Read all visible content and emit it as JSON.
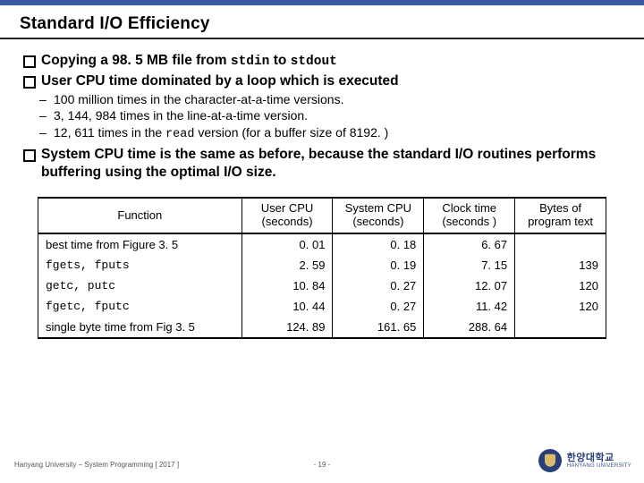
{
  "title": "Standard I/O Efficiency",
  "bullets": {
    "copying": {
      "a": "Copying a 98. 5 MB file from ",
      "stdin": "stdin",
      "b": " to ",
      "stdout": "stdout"
    },
    "user_cpu_head": "User CPU time dominated by a loop which is executed",
    "sub1": "100 million times in the character-at-a-time versions.",
    "sub2": "3, 144, 984 times in the line-at-a-time version.",
    "sub3": {
      "a": "12, 611 times in the ",
      "code": "read",
      "b": " version (for a buffer size of 8192. )"
    },
    "syscpu": "System CPU time is the same as before, because the standard I/O routines performs buffering using the optimal I/O size."
  },
  "table": {
    "headers": {
      "fn": "Function",
      "ucpu": "User CPU (seconds)",
      "scpu": "System CPU (seconds)",
      "clock": "Clock time (seconds )",
      "bytes": "Bytes of program text"
    },
    "rows": [
      {
        "fn_text": "best time from Figure 3. 5",
        "fn_mono": "",
        "ucpu": "0. 01",
        "scpu": "0. 18",
        "clock": "6. 67",
        "bytes": ""
      },
      {
        "fn_text": "",
        "fn_mono": "fgets, fputs",
        "ucpu": "2. 59",
        "scpu": "0. 19",
        "clock": "7. 15",
        "bytes": "139"
      },
      {
        "fn_text": "",
        "fn_mono": "getc, putc",
        "ucpu": "10. 84",
        "scpu": "0. 27",
        "clock": "12. 07",
        "bytes": "120"
      },
      {
        "fn_text": "",
        "fn_mono": "fgetc, fputc",
        "ucpu": "10. 44",
        "scpu": "0. 27",
        "clock": "11. 42",
        "bytes": "120"
      },
      {
        "fn_text": "single byte time from Fig 3. 5",
        "fn_mono": "",
        "ucpu": "124. 89",
        "scpu": "161. 65",
        "clock": "288. 64",
        "bytes": ""
      }
    ]
  },
  "footer": {
    "left": "Hanyang University – System Programming [ 2017 ]",
    "page": "- 19 -",
    "uni_kr": "한양대학교",
    "uni_en": "HANYANG UNIVERSITY"
  }
}
